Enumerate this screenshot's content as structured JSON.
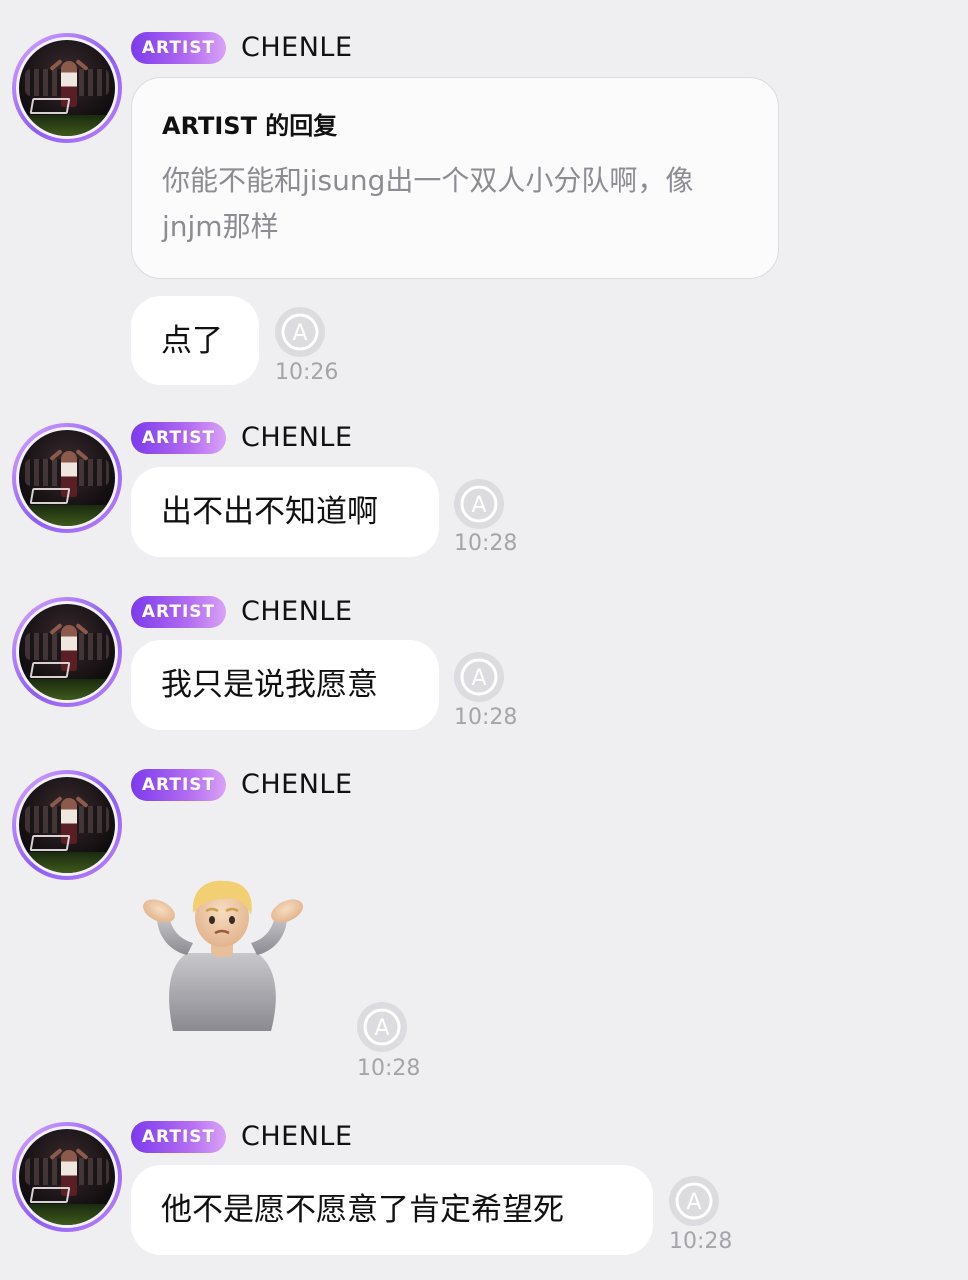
{
  "messages": [
    {
      "badge": "ARTIST",
      "sender": "CHENLE",
      "reply_title": "ARTIST 的回复",
      "reply_text": [
        "你能不能和jisung出一个双人小分队啊，像",
        "jnjm那样"
      ],
      "text": "点了",
      "time": "10:26"
    },
    {
      "badge": "ARTIST",
      "sender": "CHENLE",
      "text": "出不出不知道啊",
      "time": "10:28"
    },
    {
      "badge": "ARTIST",
      "sender": "CHENLE",
      "text": "我只是说我愿意",
      "time": "10:28"
    },
    {
      "badge": "ARTIST",
      "sender": "CHENLE",
      "emoji": "person-shrugging-emoji",
      "time": "10:28"
    },
    {
      "badge": "ARTIST",
      "sender": "CHENLE",
      "text": "他不是愿不愿意了肯定希望死",
      "time": "10:28"
    }
  ],
  "icons": {
    "translate": "translate-icon",
    "avatar": "avatar"
  },
  "colors": {
    "background": "#efeff1",
    "badge_start": "#7c3aed",
    "badge_end": "#d9a3f7",
    "bubble": "#ffffff",
    "timestamp": "#a4a4aa",
    "reply_text": "#8c8c92"
  }
}
